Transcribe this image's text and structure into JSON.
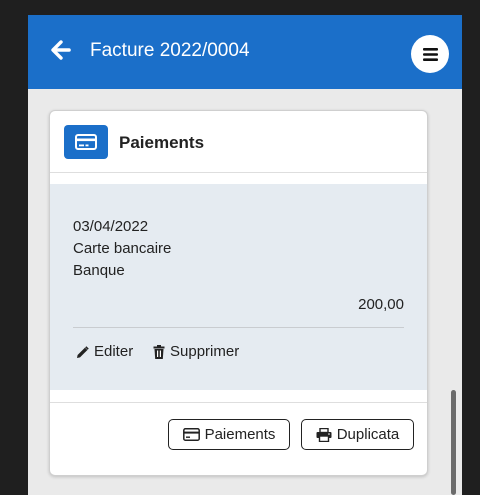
{
  "app_bar": {
    "title": "Facture 2022/0004",
    "back_icon": "arrow-left-icon",
    "menu_icon": "hamburger-icon",
    "color": "#1b6fc9"
  },
  "payments_card": {
    "title": "Paiements",
    "header_icon": "credit-card-icon",
    "items": [
      {
        "date": "03/04/2022",
        "method": "Carte bancaire",
        "account": "Banque",
        "amount": "200,00",
        "edit_label": "Editer",
        "delete_label": "Supprimer"
      }
    ],
    "footer": {
      "payments_button": "Paiements",
      "duplicate_button": "Duplicata"
    }
  }
}
